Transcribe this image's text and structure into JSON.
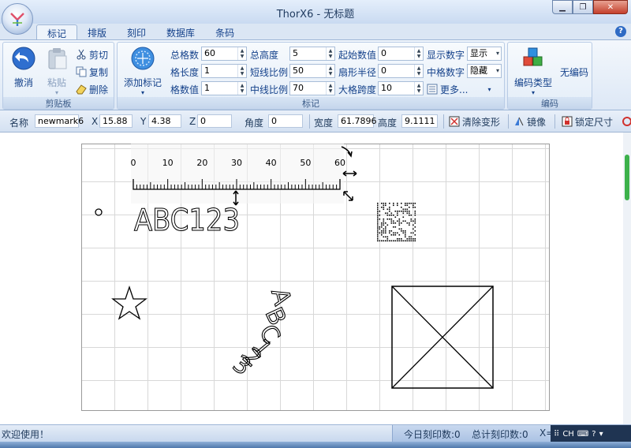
{
  "window": {
    "title": "ThorX6 - 无标题"
  },
  "tabs": [
    "标记",
    "排版",
    "刻印",
    "数据库",
    "条码"
  ],
  "ribbon": {
    "clipboard": {
      "label": "剪贴板",
      "undo": "撤消",
      "paste": "粘贴",
      "cut": "剪切",
      "copy": "复制",
      "delete": "删除"
    },
    "mark": {
      "label": "标记",
      "add_mark": "添加标记",
      "fields": {
        "total_cells": {
          "label": "总格数",
          "value": "60"
        },
        "cell_length": {
          "label": "格长度",
          "value": "1"
        },
        "cell_value": {
          "label": "格数值",
          "value": "1"
        },
        "total_height": {
          "label": "总高度",
          "value": "5"
        },
        "short_ratio": {
          "label": "短线比例",
          "value": "50"
        },
        "mid_ratio": {
          "label": "中线比例",
          "value": "70"
        },
        "start_value": {
          "label": "起始数值",
          "value": "0"
        },
        "sector_radius": {
          "label": "扇形半径",
          "value": "0"
        },
        "big_span": {
          "label": "大格跨度",
          "value": "10"
        },
        "show_number": {
          "label": "显示数字",
          "value": "显示"
        },
        "mid_number": {
          "label": "中格数字",
          "value": "隐藏"
        },
        "more": "更多..."
      }
    },
    "encode": {
      "label": "编码",
      "encode_type": "编码类型",
      "no_encode": "无编码"
    }
  },
  "props": {
    "name_label": "名称",
    "name_value": "newmark6",
    "x_label": "X",
    "x_value": "15.88",
    "y_label": "Y",
    "y_value": "4.38",
    "z_label": "Z",
    "z_value": "0",
    "angle_label": "角度",
    "angle_value": "0",
    "width_label": "宽度",
    "width_value": "61.7896",
    "height_label": "高度",
    "height_value": "9.1111",
    "clear_transform": "清除变形",
    "mirror": "镜像",
    "lock_size": "锁定尺寸"
  },
  "canvas": {
    "ruler_labels": [
      "0",
      "10",
      "20",
      "30",
      "40",
      "50",
      "60"
    ],
    "text1": "ABC123",
    "text2_chars": [
      "A",
      "B",
      "C",
      "1",
      "2",
      "3"
    ]
  },
  "status": {
    "welcome": "欢迎使用！",
    "today_count": "今日刻印数:0",
    "total_count": "总计刻印数:0",
    "x_readout": "X=",
    "ime": "CH"
  },
  "colors": {
    "accent": "#15428b",
    "grid": "#d8d8d8",
    "scroll_thumb": "#3cb14b"
  }
}
